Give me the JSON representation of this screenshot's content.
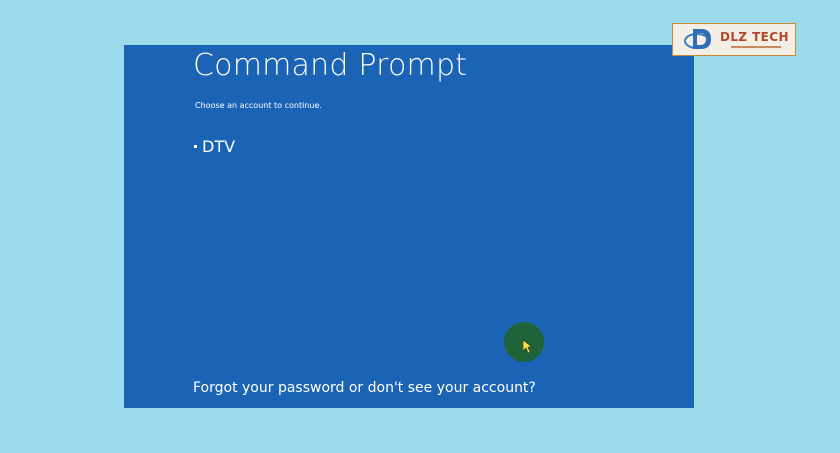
{
  "screen": {
    "title": "Command Prompt",
    "subtitle": "Choose an account to continue.",
    "accounts": [
      {
        "name": "DTV"
      }
    ],
    "forgot_link": "Forgot your password or don't see your account?"
  },
  "watermark": {
    "brand": "DLZ TECH",
    "icon": "dlz-tech-logo"
  },
  "colors": {
    "page_background": "#9bdbeb",
    "screen_background": "#1b63b5",
    "text": "#ffffff",
    "cursor_highlight": "#1f6438",
    "logo_accent": "#b3472c"
  }
}
